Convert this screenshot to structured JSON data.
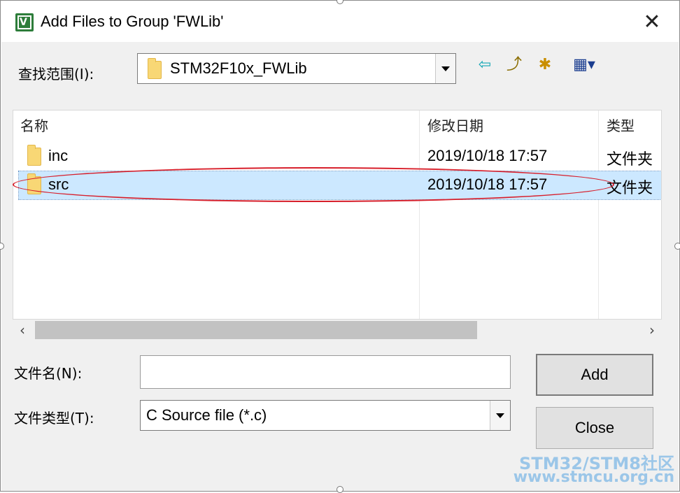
{
  "window": {
    "title": "Add Files to Group 'FWLib'",
    "close_symbol": "✕"
  },
  "lookin": {
    "label": "查找范围(I):",
    "value": "STM32F10x_FWLib"
  },
  "toolbar": {
    "back_glyph": "⇦",
    "up_glyph": "⤴",
    "newfolder_glyph": "✱",
    "view_glyph": "▦▾"
  },
  "list": {
    "columns": [
      "名称",
      "修改日期",
      "类型"
    ],
    "sort_indicator": "^",
    "rows": [
      {
        "name": "inc",
        "date": "2019/10/18 17:57",
        "type": "文件夹"
      },
      {
        "name": "src",
        "date": "2019/10/18 17:57",
        "type": "文件夹"
      }
    ]
  },
  "scroll": {
    "left": "‹",
    "right": "›"
  },
  "filename": {
    "label": "文件名(N):",
    "value": ""
  },
  "filetype": {
    "label": "文件类型(T):",
    "value": "C Source file (*.c)"
  },
  "buttons": {
    "add": "Add",
    "close": "Close"
  },
  "watermark": {
    "line1": "STM32/STM8社区",
    "line2": "www.stmcu.org.cn"
  },
  "colors": {
    "selection": "#cce8ff",
    "annotation": "#d71f2b",
    "watermark": "#9bc6e8"
  }
}
